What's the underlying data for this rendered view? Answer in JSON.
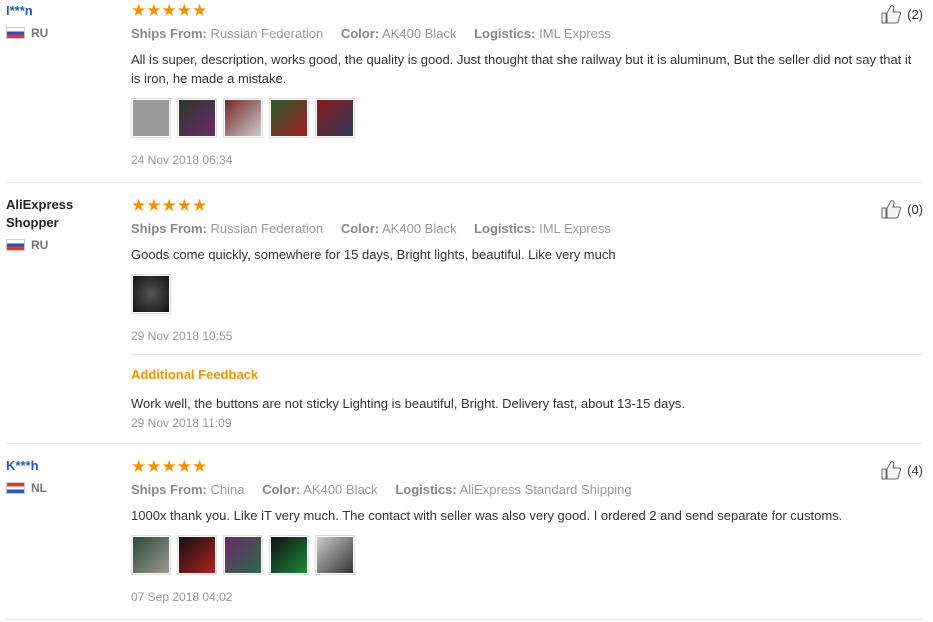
{
  "labels": {
    "ships_from": "Ships From:",
    "color": "Color:",
    "logistics": "Logistics:",
    "additional_feedback": "Additional Feedback"
  },
  "reviews": [
    {
      "user": "I***n",
      "country": "RU",
      "stars": "★★★★★",
      "ships_from": "Russian Federation",
      "color": "AK400 Black",
      "logistics": "IML Express",
      "text": "All is super, description, works good, the quality is good. Just thought that she railway but it is aluminum, But the seller did not say that it is iron, he made a mistake.",
      "date": "24 Nov 2018 06:34",
      "likes": "(2)",
      "thumb_colors": [
        "#9a9a9a",
        "#3a4a3a",
        "#7a3a3a",
        "#4a6a2a",
        "#8a2a2a"
      ]
    },
    {
      "user": "AliExpress Shopper",
      "country": "RU",
      "stars": "★★★★★",
      "ships_from": "Russian Federation",
      "color": "AK400 Black",
      "logistics": "IML Express",
      "text": "Goods come quickly, somewhere for 15 days, Bright lights, beautiful. Like very much",
      "date": "29 Nov 2018 10:55",
      "likes": "(0)",
      "thumb_colors": [
        "#2a2a2a"
      ],
      "additional": {
        "text": "Work well, the buttons are not sticky Lighting is beautiful, Bright. Delivery fast, about 13-15 days.",
        "date": "29 Nov 2018 11:09"
      }
    },
    {
      "user": "K***h",
      "country": "NL",
      "stars": "★★★★★",
      "ships_from": "China",
      "color": "AK400 Black",
      "logistics": "AliExpress Standard Shipping",
      "text": "1000x thank you. Like iT very much. The contact with seller was also very good. I ordered 2 and send separate for customs.",
      "date": "07 Sep 2018 04:02",
      "likes": "(4)",
      "thumb_colors": [
        "#4a6a4a",
        "#3a3a3a",
        "#5a3a5a",
        "#2a4a3a",
        "#6a6a6a"
      ]
    }
  ]
}
